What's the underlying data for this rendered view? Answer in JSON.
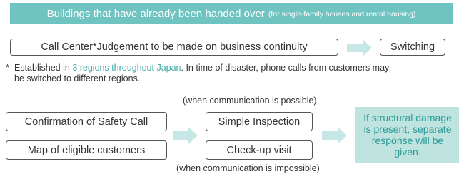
{
  "header": {
    "title": "Buildings that have already been handed over",
    "subtitle": "(for single-family houses and rental housing)"
  },
  "call_center": {
    "label": "Call Center*Judgement to be made on business continuity",
    "switching": "Switching"
  },
  "note": {
    "star": "*",
    "before": "Established in ",
    "highlight": "3 regions throughout Japan",
    "after": ". In time of disaster, phone calls from customers may",
    "line2": "be switched to different regions."
  },
  "flow": {
    "caption_top": "(when communication is possible)",
    "caption_bottom": "(when communication is impossible)",
    "left": [
      "Confirmation of Safety Call",
      "Map of eligible customers"
    ],
    "middle": [
      "Simple Inspection",
      "Check-up visit"
    ],
    "result": "If structural damage is present, separate response will be given."
  },
  "colors": {
    "accent": "#6fc3c1",
    "arrow": "#c6e7e5",
    "result_bg": "#bfe3df",
    "result_text": "#2a9b96",
    "highlight_text": "#3fa9a6"
  }
}
